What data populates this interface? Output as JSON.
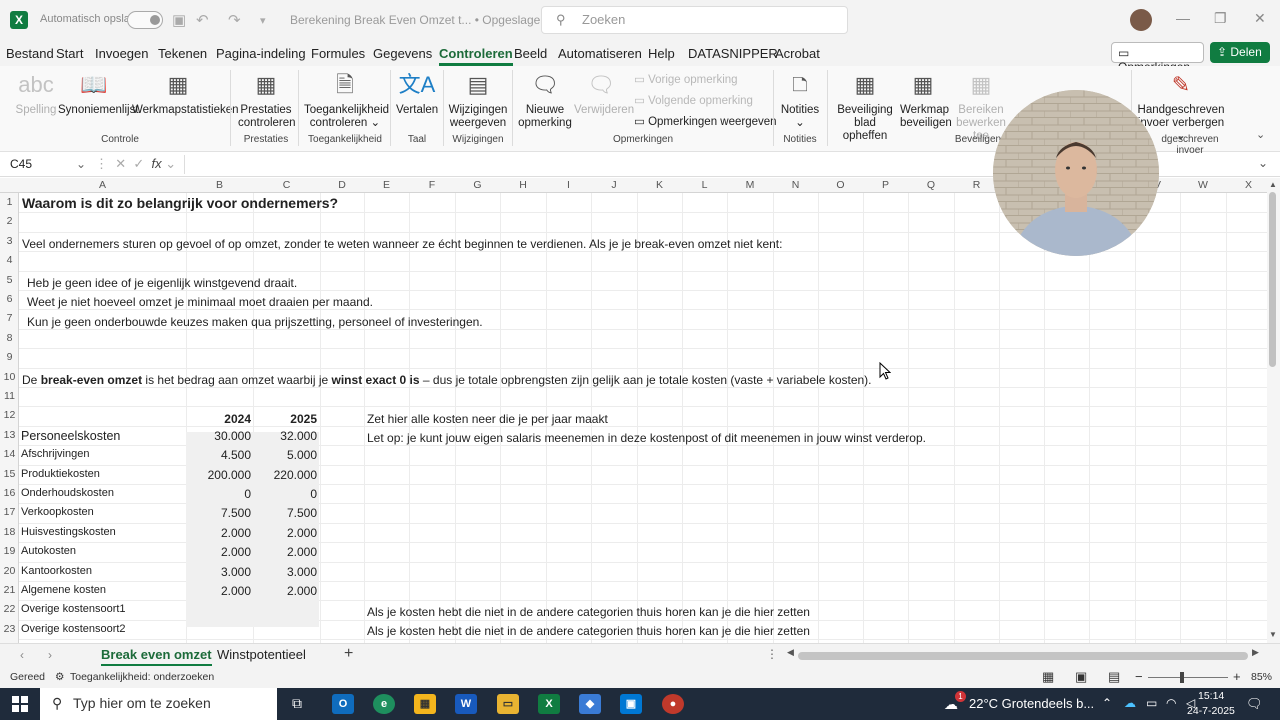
{
  "titlebar": {
    "autosave_label": "Automatisch opslaan",
    "document_title": "Berekening Break Even Omzet t... • Opgeslagen ⌄",
    "search_placeholder": "Zoeken"
  },
  "menu": {
    "tabs": [
      "Bestand",
      "Start",
      "Invoegen",
      "Tekenen",
      "Pagina-indeling",
      "Formules",
      "Gegevens",
      "Controleren",
      "Beeld",
      "Automatiseren",
      "Help",
      "DATASNIPPER",
      "Acrobat"
    ],
    "active_tab": "Controleren",
    "comments_button": "Opmerkingen",
    "share_button": "Delen"
  },
  "ribbon": {
    "spelling": "Spelling",
    "thesaurus": "Synoniemenlijst",
    "workbook_stats": "Werkmapstatistieken",
    "group_controle": "Controle",
    "performance_1": "Prestaties",
    "performance_2": "controleren",
    "group_performance": "Prestaties",
    "access_1": "Toegankelijkheid",
    "access_2": "controleren",
    "group_access": "Toegankelijkheid",
    "translate": "Vertalen",
    "group_language": "Taal",
    "changes_1": "Wijzigingen",
    "changes_2": "weergeven",
    "group_changes": "Wijzigingen",
    "new_comment_1": "Nieuwe",
    "new_comment_2": "opmerking",
    "delete": "Verwijderen",
    "prev_comment": "Vorige opmerking",
    "next_comment": "Volgende opmerking",
    "show_comments": "Opmerkingen weergeven",
    "group_comments": "Opmerkingen",
    "notes": "Notities",
    "group_notes": "Notities",
    "unprotect_1": "Beveiliging",
    "unprotect_2": "blad opheffen",
    "protect_wb_1": "Werkmap",
    "protect_wb_2": "beveiligen",
    "ranges_1": "Bereiken",
    "ranges_2": "bewerken toe",
    "group_protect": "Beveiligen",
    "ink_1": "Handgeschreven",
    "ink_2": "invoer verbergen",
    "group_ink": "dgeschreven invoer"
  },
  "formula_bar": {
    "name_box": "C45",
    "fx": "fx"
  },
  "columns": [
    "A",
    "B",
    "C",
    "D",
    "E",
    "F",
    "G",
    "H",
    "I",
    "J",
    "K",
    "L",
    "M",
    "N",
    "O",
    "P",
    "Q",
    "R",
    "S",
    "T",
    "U",
    "V",
    "W",
    "X"
  ],
  "rows": [
    "1",
    "2",
    "3",
    "4",
    "5",
    "6",
    "7",
    "8",
    "9",
    "10",
    "11",
    "12",
    "13",
    "14",
    "15",
    "16",
    "17",
    "18",
    "19",
    "20",
    "21",
    "22",
    "23"
  ],
  "sheet": {
    "r1": "Waarom is dit zo belangrijk voor ondernemers?",
    "r3": "Veel ondernemers sturen op gevoel of op omzet, zonder te weten wanneer ze écht beginnen te verdienen. Als je je break-even omzet niet kent:",
    "r5": "Heb je geen idee of je eigenlijk winstgevend draait.",
    "r6": "Weet je niet hoeveel omzet je minimaal moet draaien per maand.",
    "r7": "Kun je geen onderbouwde keuzes maken qua prijszetting, personeel of investeringen.",
    "r10_a": "De ",
    "r10_b": "break-even omzet",
    "r10_c": " is het bedrag aan omzet waarbij je ",
    "r10_d": "winst exact 0 is",
    "r10_e": " – dus je totale opbrengsten zijn gelijk aan je totale kosten (vaste + variabele kosten).",
    "year1": "2024",
    "year2": "2025",
    "note12": "Zet hier alle kosten neer die je per jaar maakt",
    "note13": "Let op: je kunt jouw eigen salaris meenemen in deze kostenpost of dit meenemen in jouw winst verderop.",
    "costs": [
      {
        "label": "Personeelskosten",
        "v2024": "30.000",
        "v2025": "32.000"
      },
      {
        "label": "Afschrijvingen",
        "v2024": "4.500",
        "v2025": "5.000"
      },
      {
        "label": "Produktiekosten",
        "v2024": "200.000",
        "v2025": "220.000"
      },
      {
        "label": "Onderhoudskosten",
        "v2024": "0",
        "v2025": "0"
      },
      {
        "label": "Verkoopkosten",
        "v2024": "7.500",
        "v2025": "7.500"
      },
      {
        "label": "Huisvestingskosten",
        "v2024": "2.000",
        "v2025": "2.000"
      },
      {
        "label": "Autokosten",
        "v2024": "2.000",
        "v2025": "2.000"
      },
      {
        "label": "Kantoorkosten",
        "v2024": "3.000",
        "v2025": "3.000"
      },
      {
        "label": "Algemene kosten",
        "v2024": "2.000",
        "v2025": "2.000"
      },
      {
        "label": "Overige kostensoort1",
        "v2024": "",
        "v2025": ""
      },
      {
        "label": "Overige kostensoort2",
        "v2024": "",
        "v2025": ""
      }
    ],
    "note22": "Als je kosten hebt die niet in de andere categorien thuis horen kan je die hier zetten",
    "note23": "Als je kosten hebt die niet in de andere categorien thuis horen kan je die hier zetten"
  },
  "sheet_tabs": {
    "tab1": "Break even omzet",
    "tab2": "Winstpotentieel",
    "active": "Break even omzet"
  },
  "status": {
    "ready": "Gereed",
    "accessibility": "Toegankelijkheid: onderzoeken",
    "zoom": "85%"
  },
  "taskbar": {
    "search_placeholder": "Typ hier om te zoeken",
    "weather": "22°C  Grotendeels b...",
    "weather_badge": "1",
    "time": "15:14",
    "date": "24-7-2025"
  },
  "colors": {
    "excel_green": "#107c41",
    "taskbar": "#1f2b3b"
  }
}
